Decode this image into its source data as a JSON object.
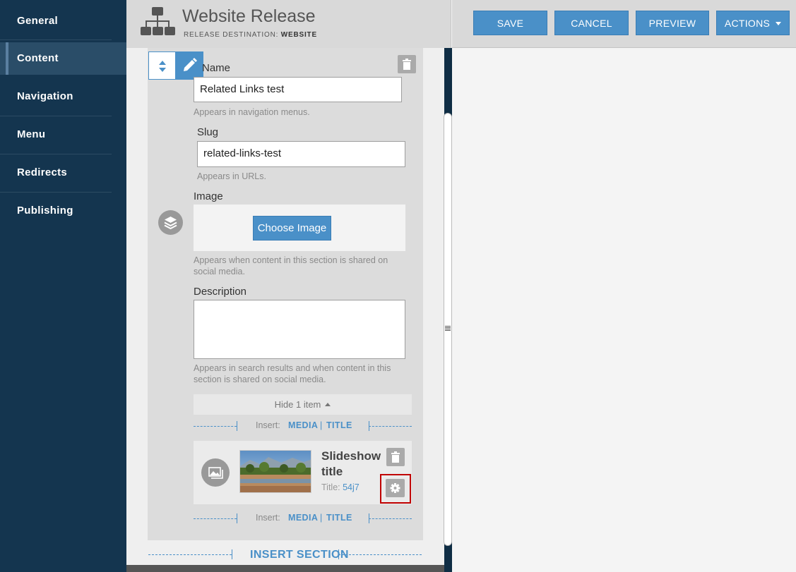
{
  "sidebar": {
    "items": [
      {
        "label": "General"
      },
      {
        "label": "Content"
      },
      {
        "label": "Navigation"
      },
      {
        "label": "Menu"
      },
      {
        "label": "Redirects"
      },
      {
        "label": "Publishing"
      }
    ],
    "active": "Content"
  },
  "header": {
    "title": "Website Release",
    "subtitle_prefix": "RELEASE DESTINATION:",
    "subtitle_value": "WEBSITE"
  },
  "toolbar": {
    "save": "SAVE",
    "cancel": "CANCEL",
    "preview": "PREVIEW",
    "actions": "ACTIONS"
  },
  "form": {
    "name_label": "Name",
    "name_value": "Related Links test",
    "name_help": "Appears in navigation menus.",
    "slug_label": "Slug",
    "slug_value": "related-links-test",
    "slug_help": "Appears in URLs.",
    "image_label": "Image",
    "choose_image": "Choose Image",
    "image_help": "Appears when content in this section is shared on social media.",
    "description_label": "Description",
    "description_value": "",
    "description_help": "Appears in search results and when content in this section is shared on social media."
  },
  "items": {
    "hide_label": "Hide 1 item",
    "insert_label": "Insert:",
    "media": "MEDIA",
    "title": "TITLE",
    "separator": "|"
  },
  "slideshow": {
    "title": "Slideshow title",
    "meta_label": "Title:",
    "meta_value": "54j7"
  },
  "insert_section": "INSERT SECTION",
  "colors": {
    "sidebar": "#14354f",
    "accent": "#4a90c8",
    "highlight": "#c00000"
  }
}
